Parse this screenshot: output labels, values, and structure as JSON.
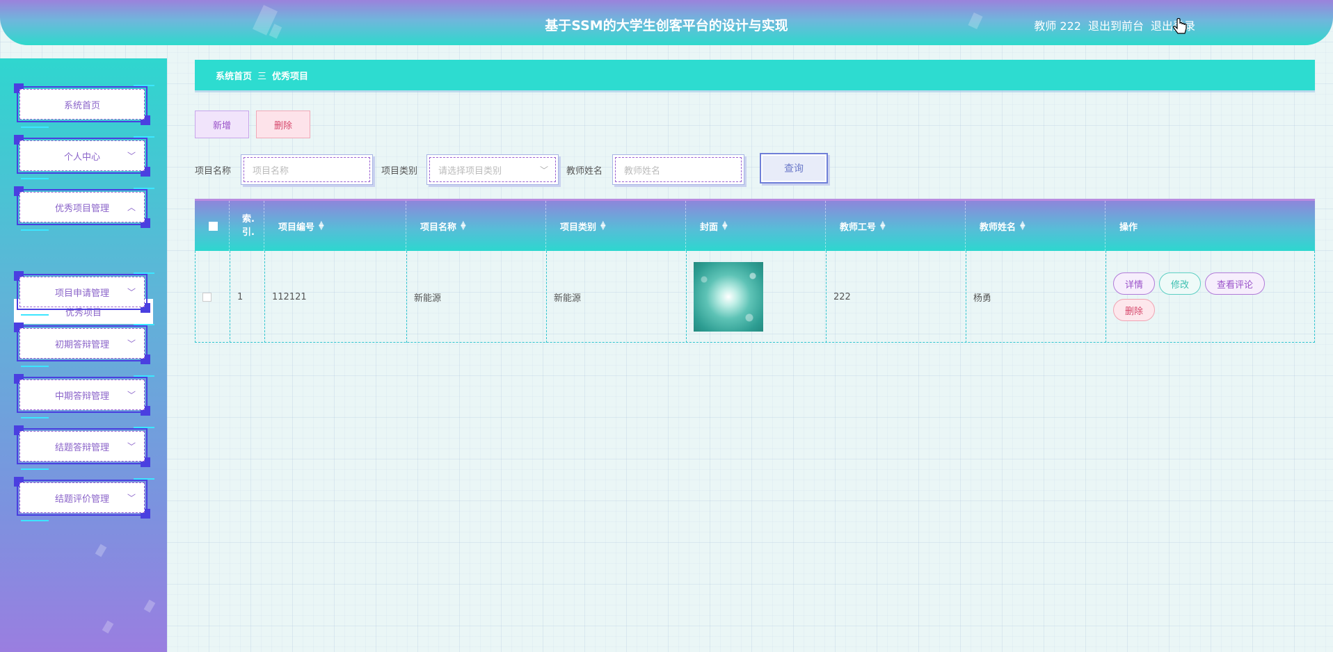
{
  "header": {
    "title": "基于SSM的大学生创客平台的设计与实现",
    "user": "教师 222",
    "to_front": "退出到前台",
    "logout": "退出登录"
  },
  "sidebar": {
    "items": [
      {
        "label": "系统首页",
        "has_arrow": false
      },
      {
        "label": "个人中心",
        "arrow": "﹀"
      },
      {
        "label": "优秀项目管理",
        "arrow": "︿"
      },
      {
        "label": "项目申请管理",
        "arrow": "﹀"
      },
      {
        "label": "初期答辩管理",
        "arrow": "﹀"
      },
      {
        "label": "中期答辩管理",
        "arrow": "﹀"
      },
      {
        "label": "结题答辩管理",
        "arrow": "﹀"
      },
      {
        "label": "结题评价管理",
        "arrow": "﹀"
      }
    ],
    "sub_item": "优秀项目"
  },
  "breadcrumb": {
    "home": "系统首页",
    "separator": "三",
    "current": "优秀项目"
  },
  "actions": {
    "add": "新增",
    "delete": "删除"
  },
  "search": {
    "name_label": "项目名称",
    "name_placeholder": "项目名称",
    "type_label": "项目类别",
    "type_placeholder": "请选择项目类别",
    "teacher_label": "教师姓名",
    "teacher_placeholder": "教师姓名",
    "query": "查询"
  },
  "table": {
    "columns": [
      "索引",
      "项目编号",
      "项目名称",
      "项目类别",
      "封面",
      "教师工号",
      "教师姓名",
      "操作"
    ],
    "index_header_line1": "索.",
    "index_header_line2": "引.",
    "rows": [
      {
        "index": "1",
        "code": "112121",
        "name": "新能源",
        "type": "新能源",
        "teacher_id": "222",
        "teacher_name": "杨勇"
      }
    ],
    "ops": {
      "detail": "详情",
      "edit": "修改",
      "comment": "查看评论",
      "delete": "删除"
    }
  },
  "colors": {
    "accent_teal": "#2ddcd0",
    "accent_purple": "#9a52c9",
    "danger": "#d6476b"
  }
}
